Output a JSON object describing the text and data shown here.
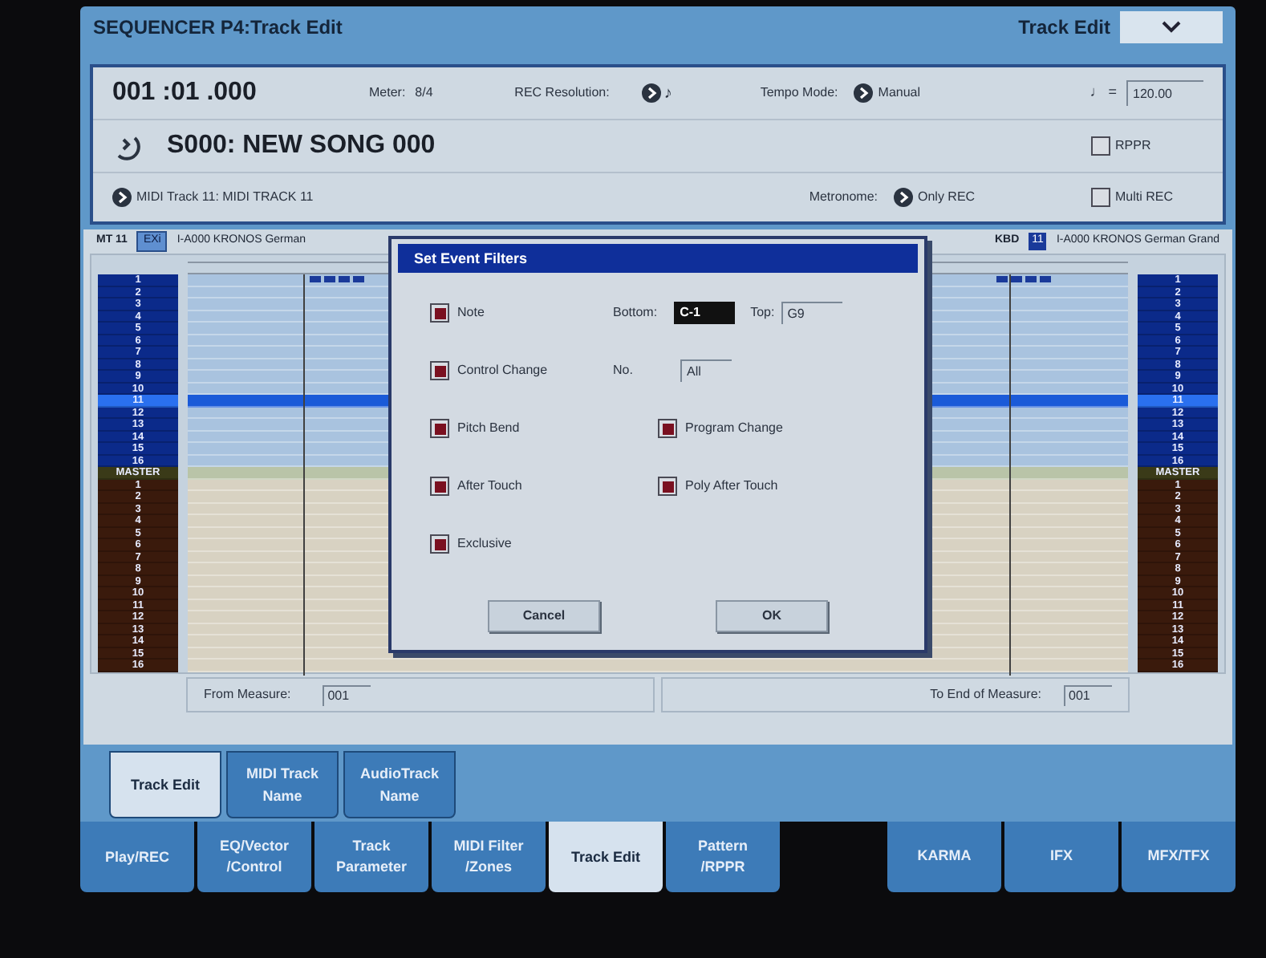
{
  "window": {
    "title": "SEQUENCER P4:Track Edit",
    "page_menu": "Track Edit"
  },
  "info": {
    "location": "001 :01 .000",
    "meter_label": "Meter:",
    "meter": "8/4",
    "rec_resolution_label": "REC Resolution:",
    "rec_resolution": "♪",
    "tempo_mode_label": "Tempo Mode:",
    "tempo_mode": "Manual",
    "tempo_label": "♩ =",
    "tempo": "120.00",
    "song": "S000: NEW SONG 000",
    "rppr": {
      "label": "RPPR",
      "checked": false
    },
    "track": "MIDI Track 11: MIDI TRACK 11",
    "metronome_label": "Metronome:",
    "metronome": "Only REC",
    "multi_rec": {
      "label": "Multi REC",
      "checked": false
    }
  },
  "track_bar": {
    "left": {
      "track": "MT 11",
      "bank": "EXi",
      "program": "I-A000 KRONOS German"
    },
    "right": {
      "source": "KBD",
      "channel": "11",
      "program": "I-A000 KRONOS German Grand"
    }
  },
  "tracks": [
    {
      "left_label": "1",
      "right_label": "1",
      "kind": "midi",
      "selected": false
    },
    {
      "left_label": "2",
      "right_label": "2",
      "kind": "midi",
      "selected": false
    },
    {
      "left_label": "3",
      "right_label": "3",
      "kind": "midi",
      "selected": false
    },
    {
      "left_label": "4",
      "right_label": "4",
      "kind": "midi",
      "selected": false
    },
    {
      "left_label": "5",
      "right_label": "5",
      "kind": "midi",
      "selected": false
    },
    {
      "left_label": "6",
      "right_label": "6",
      "kind": "midi",
      "selected": false
    },
    {
      "left_label": "7",
      "right_label": "7",
      "kind": "midi",
      "selected": false
    },
    {
      "left_label": "8",
      "right_label": "8",
      "kind": "midi",
      "selected": false
    },
    {
      "left_label": "9",
      "right_label": "9",
      "kind": "midi",
      "selected": false
    },
    {
      "left_label": "10",
      "right_label": "10",
      "kind": "midi",
      "selected": false
    },
    {
      "left_label": "11",
      "right_label": "11",
      "kind": "midi",
      "selected": true
    },
    {
      "left_label": "12",
      "right_label": "12",
      "kind": "midi",
      "selected": false
    },
    {
      "left_label": "13",
      "right_label": "13",
      "kind": "midi",
      "selected": false
    },
    {
      "left_label": "14",
      "right_label": "14",
      "kind": "midi",
      "selected": false
    },
    {
      "left_label": "15",
      "right_label": "15",
      "kind": "midi",
      "selected": false
    },
    {
      "left_label": "16",
      "right_label": "16",
      "kind": "midi",
      "selected": false
    },
    {
      "left_label": "MASTER",
      "right_label": "MASTER",
      "kind": "master",
      "selected": false
    },
    {
      "left_label": "1",
      "right_label": "1",
      "kind": "audio",
      "selected": false
    },
    {
      "left_label": "2",
      "right_label": "2",
      "kind": "audio",
      "selected": false
    },
    {
      "left_label": "3",
      "right_label": "3",
      "kind": "audio",
      "selected": false
    },
    {
      "left_label": "4",
      "right_label": "4",
      "kind": "audio",
      "selected": false
    },
    {
      "left_label": "5",
      "right_label": "5",
      "kind": "audio",
      "selected": false
    },
    {
      "left_label": "6",
      "right_label": "6",
      "kind": "audio",
      "selected": false
    },
    {
      "left_label": "7",
      "right_label": "7",
      "kind": "audio",
      "selected": false
    },
    {
      "left_label": "8",
      "right_label": "8",
      "kind": "audio",
      "selected": false
    },
    {
      "left_label": "9",
      "right_label": "9",
      "kind": "audio",
      "selected": false
    },
    {
      "left_label": "10",
      "right_label": "10",
      "kind": "audio",
      "selected": false
    },
    {
      "left_label": "11",
      "right_label": "11",
      "kind": "audio",
      "selected": false
    },
    {
      "left_label": "12",
      "right_label": "12",
      "kind": "audio",
      "selected": false
    },
    {
      "left_label": "13",
      "right_label": "13",
      "kind": "audio",
      "selected": false
    },
    {
      "left_label": "14",
      "right_label": "14",
      "kind": "audio",
      "selected": false
    },
    {
      "left_label": "15",
      "right_label": "15",
      "kind": "audio",
      "selected": false
    },
    {
      "left_label": "16",
      "right_label": "16",
      "kind": "audio",
      "selected": false
    }
  ],
  "range": {
    "from_label": "From Measure:",
    "from": "001",
    "to_label": "To End of Measure:",
    "to": "001"
  },
  "dialog": {
    "title": "Set Event Filters",
    "note": {
      "label": "Note",
      "checked": true
    },
    "bottom_label": "Bottom:",
    "bottom": "C-1",
    "top_label": "Top:",
    "top": "G9",
    "control_change": {
      "label": "Control Change",
      "checked": true
    },
    "no_label": "No.",
    "no": "All",
    "filters": [
      {
        "label": "Pitch Bend",
        "checked": true
      },
      {
        "label": "Program Change",
        "checked": true
      },
      {
        "label": "After Touch",
        "checked": true
      },
      {
        "label": "Poly After Touch",
        "checked": true
      },
      {
        "label": "Exclusive",
        "checked": true
      }
    ],
    "buttons": [
      "Cancel",
      "OK"
    ]
  },
  "sub_tabs": [
    {
      "label": "Track Edit",
      "selected": true
    },
    {
      "label": "MIDI Track\nName",
      "selected": false
    },
    {
      "label": "AudioTrack\nName",
      "selected": false
    }
  ],
  "page_tabs_left": [
    {
      "label": "Play/REC",
      "selected": false
    },
    {
      "label": "EQ/Vector\n/Control",
      "selected": false
    },
    {
      "label": "Track\nParameter",
      "selected": false
    },
    {
      "label": "MIDI Filter\n/Zones",
      "selected": false
    },
    {
      "label": "Track Edit",
      "selected": true
    },
    {
      "label": "Pattern\n/RPPR",
      "selected": false
    }
  ],
  "page_tabs_right": [
    {
      "label": "KARMA",
      "selected": false
    },
    {
      "label": "IFX",
      "selected": false
    },
    {
      "label": "MFX/TFX",
      "selected": false
    }
  ]
}
